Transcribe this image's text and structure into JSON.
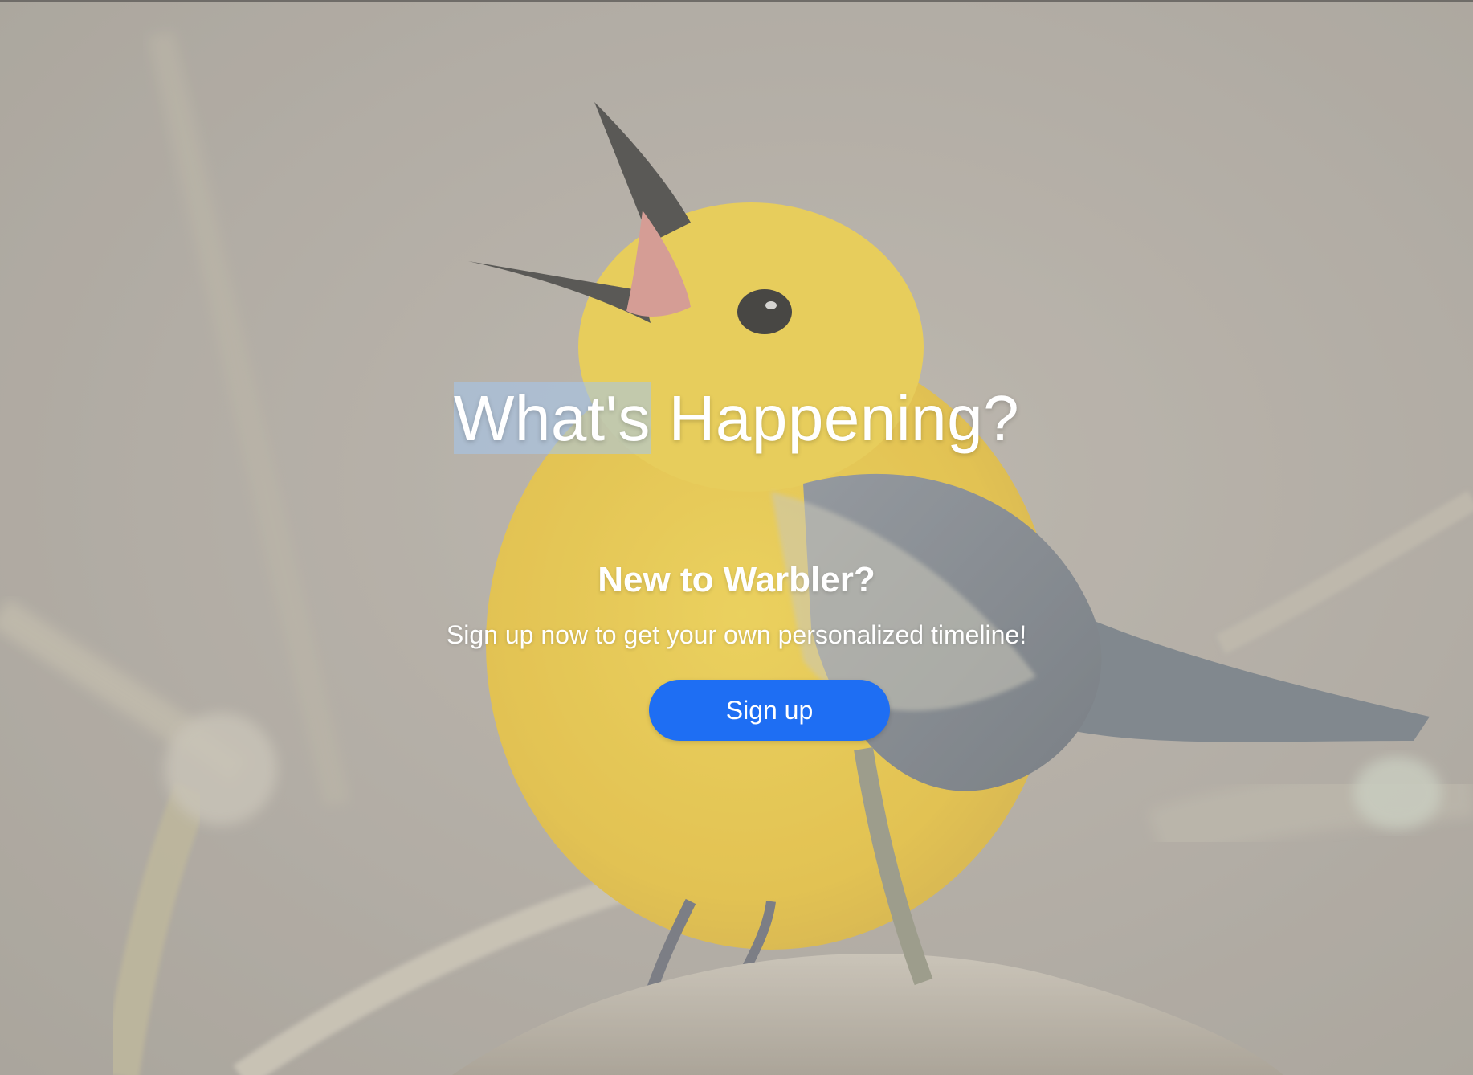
{
  "hero": {
    "background_image": "yellow warbler bird singing on branch",
    "headline_selected": "What's",
    "headline_rest": " Happening?",
    "subheading": "New to Warbler?",
    "tagline": "Sign up now to get your own personalized timeline!",
    "signup_label": "Sign up"
  },
  "colors": {
    "button": "#1e6ef3",
    "text": "#ffffff",
    "selection": "#a4c6ee"
  }
}
